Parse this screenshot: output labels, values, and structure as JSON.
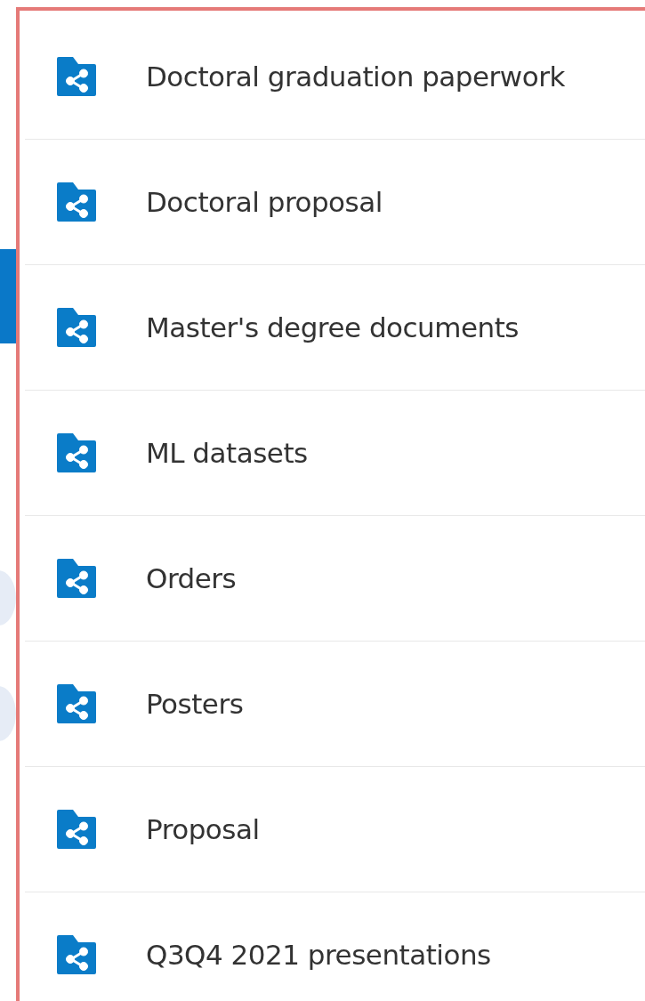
{
  "folders": [
    {
      "name": "Doctoral graduation paperwork",
      "shared": true
    },
    {
      "name": "Doctoral proposal",
      "shared": true
    },
    {
      "name": "Master's degree documents",
      "shared": true
    },
    {
      "name": "ML datasets",
      "shared": true
    },
    {
      "name": "Orders",
      "shared": true
    },
    {
      "name": "Posters",
      "shared": true
    },
    {
      "name": "Proposal",
      "shared": true
    },
    {
      "name": "Q3Q4 2021 presentations",
      "shared": true
    }
  ]
}
